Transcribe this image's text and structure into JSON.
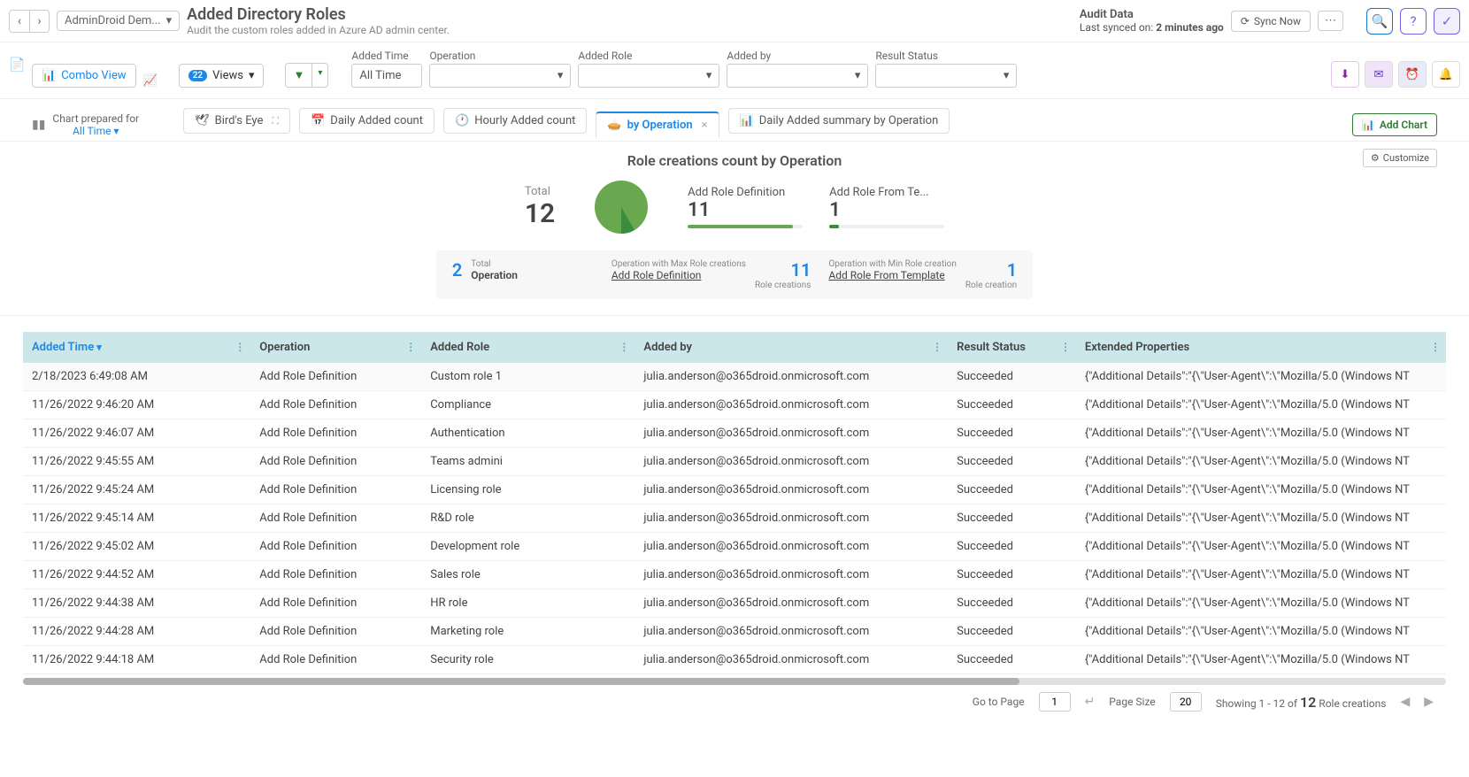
{
  "header": {
    "app_name": "AdminDroid Dem...",
    "title": "Added Directory Roles",
    "subtitle": "Audit the custom roles added in Azure AD admin center.",
    "audit_title": "Audit Data",
    "synced_label": "Last synced on:",
    "synced_value": "2 minutes ago",
    "sync_btn": "Sync Now"
  },
  "toolbar": {
    "combo_view": "Combo View",
    "views_count": "22",
    "views_label": "Views",
    "filters": {
      "added_time": {
        "label": "Added Time",
        "value": "All Time"
      },
      "operation": {
        "label": "Operation",
        "value": ""
      },
      "added_role": {
        "label": "Added Role",
        "value": ""
      },
      "added_by": {
        "label": "Added by",
        "value": ""
      },
      "result_status": {
        "label": "Result Status",
        "value": ""
      }
    }
  },
  "chart_tabs": {
    "prep_label": "Chart prepared for",
    "prep_value": "All Time",
    "tabs": {
      "birds_eye": "Bird's Eye",
      "daily_count": "Daily Added count",
      "hourly_count": "Hourly Added count",
      "by_operation": "by Operation",
      "daily_summary": "Daily Added summary by Operation"
    },
    "add_chart": "Add Chart",
    "customize": "Customize"
  },
  "chart_data": {
    "type": "pie",
    "title": "Role creations count by Operation",
    "total_label": "Total",
    "total_value": 12,
    "series": [
      {
        "name": "Add Role Definition",
        "value": 11,
        "color": "#6aa84f"
      },
      {
        "name": "Add Role From Te...",
        "value": 1,
        "color": "#388e3c"
      }
    ],
    "stats": {
      "total_op_num": "2",
      "total_op_lbl_top": "Total",
      "total_op_lbl_bot": "Operation",
      "max_lbl": "Operation with Max Role creations",
      "max_name": "Add Role Definition",
      "max_val": "11",
      "max_unit": "Role creations",
      "min_lbl": "Operation with Min Role creation",
      "min_name": "Add Role From Template",
      "min_val": "1",
      "min_unit": "Role creation"
    }
  },
  "table": {
    "columns": [
      "Added Time",
      "Operation",
      "Added Role",
      "Added by",
      "Result Status",
      "Extended Properties"
    ],
    "rows": [
      [
        "2/18/2023 6:49:08 AM",
        "Add Role Definition",
        "Custom role 1",
        "julia.anderson@o365droid.onmicrosoft.com",
        "Succeeded",
        "{\"Additional Details\":\"{\\\"User-Agent\\\":\\\"Mozilla/5.0 (Windows NT"
      ],
      [
        "11/26/2022 9:46:20 AM",
        "Add Role Definition",
        "Compliance",
        "julia.anderson@o365droid.onmicrosoft.com",
        "Succeeded",
        "{\"Additional Details\":\"{\\\"User-Agent\\\":\\\"Mozilla/5.0 (Windows NT"
      ],
      [
        "11/26/2022 9:46:07 AM",
        "Add Role Definition",
        "Authentication",
        "julia.anderson@o365droid.onmicrosoft.com",
        "Succeeded",
        "{\"Additional Details\":\"{\\\"User-Agent\\\":\\\"Mozilla/5.0 (Windows NT"
      ],
      [
        "11/26/2022 9:45:55 AM",
        "Add Role Definition",
        "Teams admini",
        "julia.anderson@o365droid.onmicrosoft.com",
        "Succeeded",
        "{\"Additional Details\":\"{\\\"User-Agent\\\":\\\"Mozilla/5.0 (Windows NT"
      ],
      [
        "11/26/2022 9:45:24 AM",
        "Add Role Definition",
        "Licensing role",
        "julia.anderson@o365droid.onmicrosoft.com",
        "Succeeded",
        "{\"Additional Details\":\"{\\\"User-Agent\\\":\\\"Mozilla/5.0 (Windows NT"
      ],
      [
        "11/26/2022 9:45:14 AM",
        "Add Role Definition",
        "R&D role",
        "julia.anderson@o365droid.onmicrosoft.com",
        "Succeeded",
        "{\"Additional Details\":\"{\\\"User-Agent\\\":\\\"Mozilla/5.0 (Windows NT"
      ],
      [
        "11/26/2022 9:45:02 AM",
        "Add Role Definition",
        "Development role",
        "julia.anderson@o365droid.onmicrosoft.com",
        "Succeeded",
        "{\"Additional Details\":\"{\\\"User-Agent\\\":\\\"Mozilla/5.0 (Windows NT"
      ],
      [
        "11/26/2022 9:44:52 AM",
        "Add Role Definition",
        "Sales role",
        "julia.anderson@o365droid.onmicrosoft.com",
        "Succeeded",
        "{\"Additional Details\":\"{\\\"User-Agent\\\":\\\"Mozilla/5.0 (Windows NT"
      ],
      [
        "11/26/2022 9:44:38 AM",
        "Add Role Definition",
        "HR role",
        "julia.anderson@o365droid.onmicrosoft.com",
        "Succeeded",
        "{\"Additional Details\":\"{\\\"User-Agent\\\":\\\"Mozilla/5.0 (Windows NT"
      ],
      [
        "11/26/2022 9:44:28 AM",
        "Add Role Definition",
        "Marketing role",
        "julia.anderson@o365droid.onmicrosoft.com",
        "Succeeded",
        "{\"Additional Details\":\"{\\\"User-Agent\\\":\\\"Mozilla/5.0 (Windows NT"
      ],
      [
        "11/26/2022 9:44:18 AM",
        "Add Role Definition",
        "Security role",
        "julia.anderson@o365droid.onmicrosoft.com",
        "Succeeded",
        "{\"Additional Details\":\"{\\\"User-Agent\\\":\\\"Mozilla/5.0 (Windows NT"
      ]
    ]
  },
  "footer": {
    "go_to_page": "Go to Page",
    "page_val": "1",
    "page_size_lbl": "Page Size",
    "page_size_val": "20",
    "showing_prefix": "Showing 1 - 12 of",
    "total": "12",
    "entity": "Role creations"
  }
}
